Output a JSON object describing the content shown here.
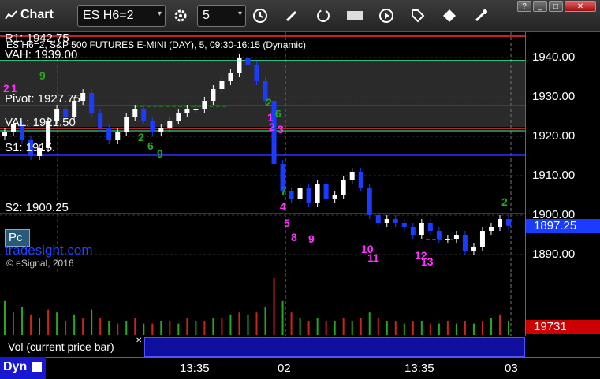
{
  "toolbar": {
    "title": "Chart",
    "symbol": "ES H6=2",
    "interval": "5",
    "icons": [
      "chart-icon",
      "gear-icon",
      "clock-icon",
      "pencil-icon",
      "refresh-icon",
      "template-icon",
      "play-icon",
      "tag-icon",
      "settings-icon"
    ],
    "window_buttons": [
      "?",
      "_",
      "□",
      "✕"
    ]
  },
  "chart": {
    "header": "ES H6=2, S&P 500 FUTURES E-MINI (DAY), 5, 09:30-16:15 (Dynamic)",
    "watermark": "tradesight.com",
    "copyright": "© eSignal, 2016",
    "pc_badge": "Pc",
    "levels": {
      "r1": "R1: 1942.75",
      "vah": "VAH: 1939.00",
      "pivot": "Pivot: 1927.75",
      "val": "VAL: 1921.50",
      "s1": "S1: 1915.",
      "s2": "S2: 1900.25"
    },
    "colors": {
      "up": "#ffffff",
      "down": "#1a3cff",
      "magenta": "#ff33ff",
      "green": "#22aa22",
      "r1": "#ff3030",
      "vah": "#33ffaa",
      "pivot": "#3030ff"
    }
  },
  "price_axis": {
    "ticks": [
      "1940.00",
      "1930.00",
      "1920.00",
      "1910.00",
      "1900.00",
      "1890.00"
    ],
    "last_price": "1897.25",
    "volume": "19731"
  },
  "volume_pane": {
    "legend": "Vol (current price bar)"
  },
  "time_axis": {
    "labels": [
      "13:35",
      "02",
      "13:35",
      "03"
    ]
  },
  "footer": {
    "dyn_label": "Dyn"
  },
  "chart_data": {
    "type": "candlestick",
    "ylim": [
      1886,
      1946
    ],
    "x": [
      "13:35",
      "02",
      "13:35",
      "03"
    ],
    "close": [
      1921,
      1923,
      1919,
      1915,
      1917,
      1924,
      1927,
      1925,
      1929,
      1931,
      1926,
      1922,
      1919,
      1921,
      1925,
      1927,
      1924,
      1921,
      1922,
      1924,
      1926,
      1927,
      1927,
      1929,
      1932,
      1934,
      1936,
      1940,
      1938,
      1934,
      1929,
      1913,
      1906,
      1904,
      1907,
      1903,
      1908,
      1904,
      1905,
      1909,
      1911,
      1907,
      1900,
      1898,
      1899,
      1898,
      1897,
      1895,
      1898,
      1896,
      1894,
      1894,
      1895,
      1891,
      1892,
      1896,
      1897,
      1899,
      1897.25
    ],
    "volume": [
      12,
      8,
      10,
      7,
      6,
      9,
      8,
      5,
      7,
      6,
      9,
      6,
      5,
      4,
      5,
      6,
      4,
      4,
      5,
      5,
      4,
      6,
      5,
      5,
      6,
      6,
      7,
      8,
      7,
      8,
      10,
      20,
      12,
      8,
      6,
      5,
      6,
      5,
      5,
      6,
      5,
      6,
      8,
      6,
      5,
      5,
      4,
      5,
      5,
      4,
      4,
      5,
      4,
      5,
      4,
      5,
      6,
      7,
      5
    ]
  }
}
